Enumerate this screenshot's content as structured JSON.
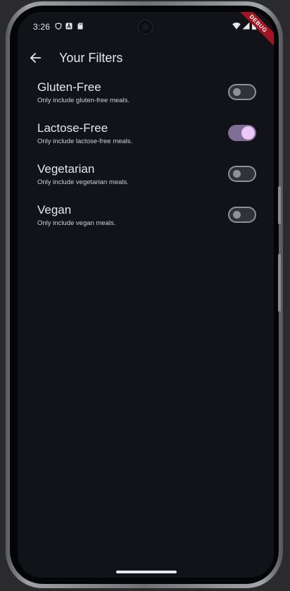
{
  "status_bar": {
    "time": "3:26",
    "debug_banner": "DEBUG"
  },
  "app_bar": {
    "back_icon": "arrow-left-icon",
    "title": "Your Filters"
  },
  "filters": [
    {
      "title": "Gluten-Free",
      "subtitle": "Only include gluten-free meals.",
      "enabled": false
    },
    {
      "title": "Lactose-Free",
      "subtitle": "Only include lactose-free meals.",
      "enabled": true
    },
    {
      "title": "Vegetarian",
      "subtitle": "Only include vegetarian meals.",
      "enabled": false
    },
    {
      "title": "Vegan",
      "subtitle": "Only include vegan meals.",
      "enabled": false
    }
  ],
  "colors": {
    "background": "#121318",
    "switch_on_track": "#7f6f96",
    "switch_on_thumb": "#ecc8f6",
    "switch_off_outline": "#8e909a"
  }
}
